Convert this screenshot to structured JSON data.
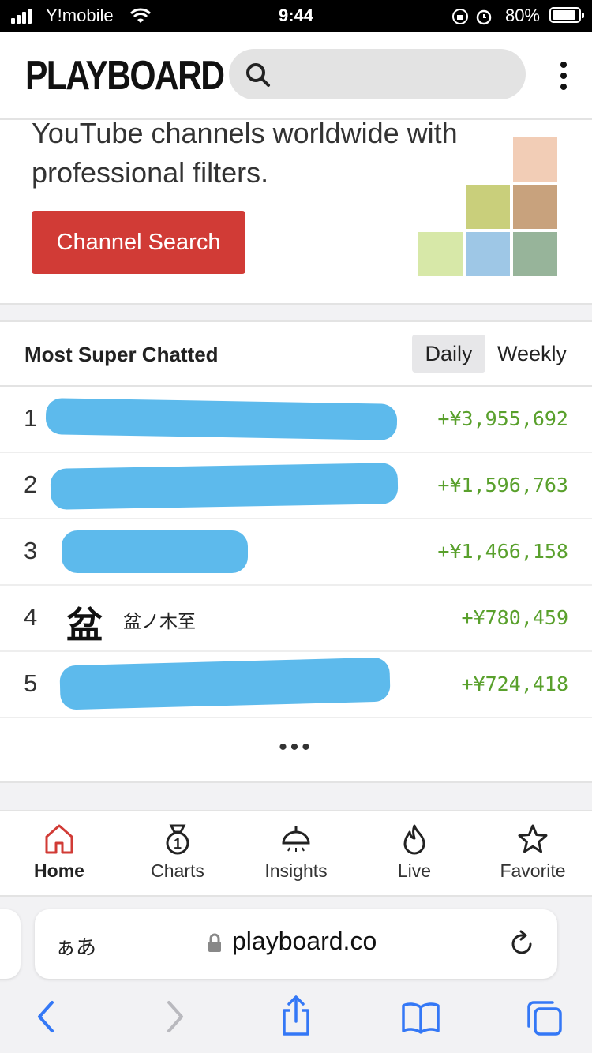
{
  "status_bar": {
    "carrier": "Y!mobile",
    "time": "9:44",
    "battery": "80%"
  },
  "header": {
    "logo": "PLAYBOARD",
    "search_placeholder": ""
  },
  "promo": {
    "description": "YouTube channels worldwide with professional filters.",
    "button_label": "Channel Search"
  },
  "chart": {
    "title": "Most Super Chatted",
    "tabs": {
      "daily": "Daily",
      "weekly": "Weekly",
      "selected": "Daily"
    },
    "rows": [
      {
        "rank": "1",
        "name": "",
        "amount": "+¥3,955,692"
      },
      {
        "rank": "2",
        "name": "",
        "amount": "+¥1,596,763"
      },
      {
        "rank": "3",
        "name": "",
        "amount": "+¥1,466,158"
      },
      {
        "rank": "4",
        "name": "盆ノ木至",
        "avatar_text": "盆",
        "amount": "+¥780,459"
      },
      {
        "rank": "5",
        "name": "",
        "amount": "+¥724,418"
      }
    ],
    "more_label": "•••"
  },
  "bottom_nav": [
    {
      "label": "Home",
      "icon": "home-icon",
      "active": true
    },
    {
      "label": "Charts",
      "icon": "medal-icon"
    },
    {
      "label": "Insights",
      "icon": "lamp-icon"
    },
    {
      "label": "Live",
      "icon": "flame-icon"
    },
    {
      "label": "Favorite",
      "icon": "star-icon"
    }
  ],
  "browser": {
    "aa_label": "ぁあ",
    "url": "playboard.co"
  },
  "colors": {
    "accent_red": "#d13b36",
    "amount_green": "#59a02c",
    "redaction_blue": "#4fb4ea",
    "ios_blue": "#3478f6"
  }
}
